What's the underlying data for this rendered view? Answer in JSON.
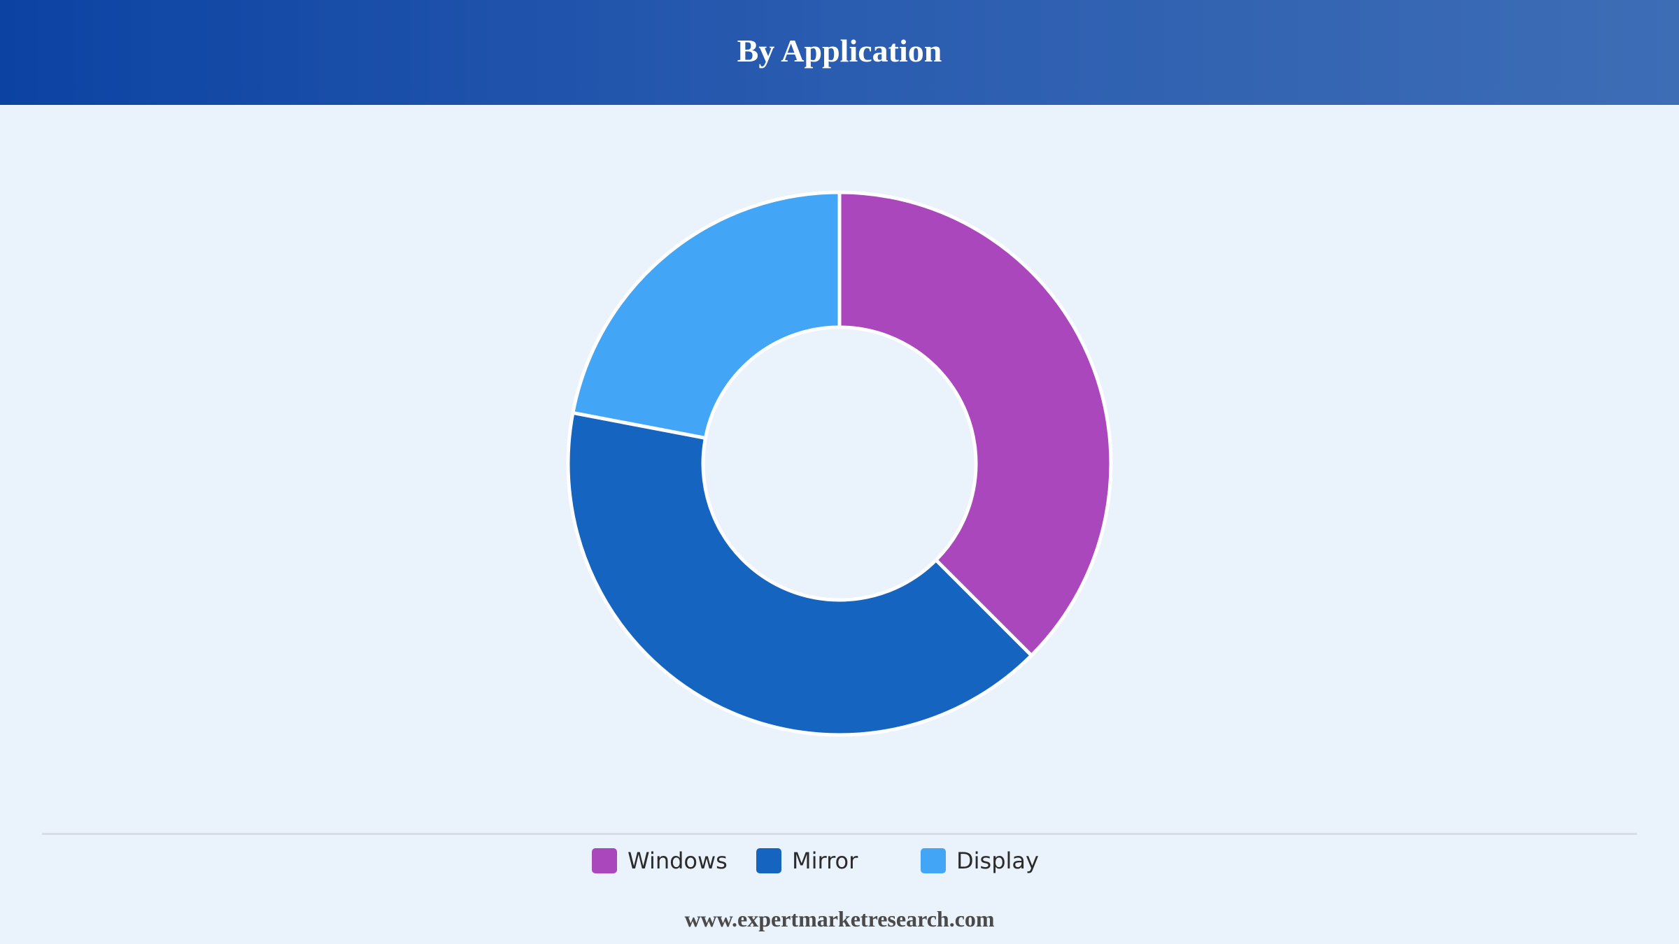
{
  "header": {
    "title": "By Application"
  },
  "chart_data": {
    "type": "pie",
    "donut": true,
    "title": "By Application",
    "categories": [
      "Windows",
      "Mirror",
      "Display"
    ],
    "values": [
      37.5,
      40.5,
      22.0
    ],
    "colors": [
      "#ab47bc",
      "#1565c0",
      "#42a5f5"
    ],
    "slice_border_color": "#ffffff",
    "legend_position": "bottom"
  },
  "legend": {
    "items": [
      {
        "label": "Windows",
        "color": "#ab47bc"
      },
      {
        "label": "Mirror",
        "color": "#1565c0"
      },
      {
        "label": "Display",
        "color": "#42a5f5"
      }
    ]
  },
  "footer": {
    "text": "www.expertmarketresearch.com"
  }
}
